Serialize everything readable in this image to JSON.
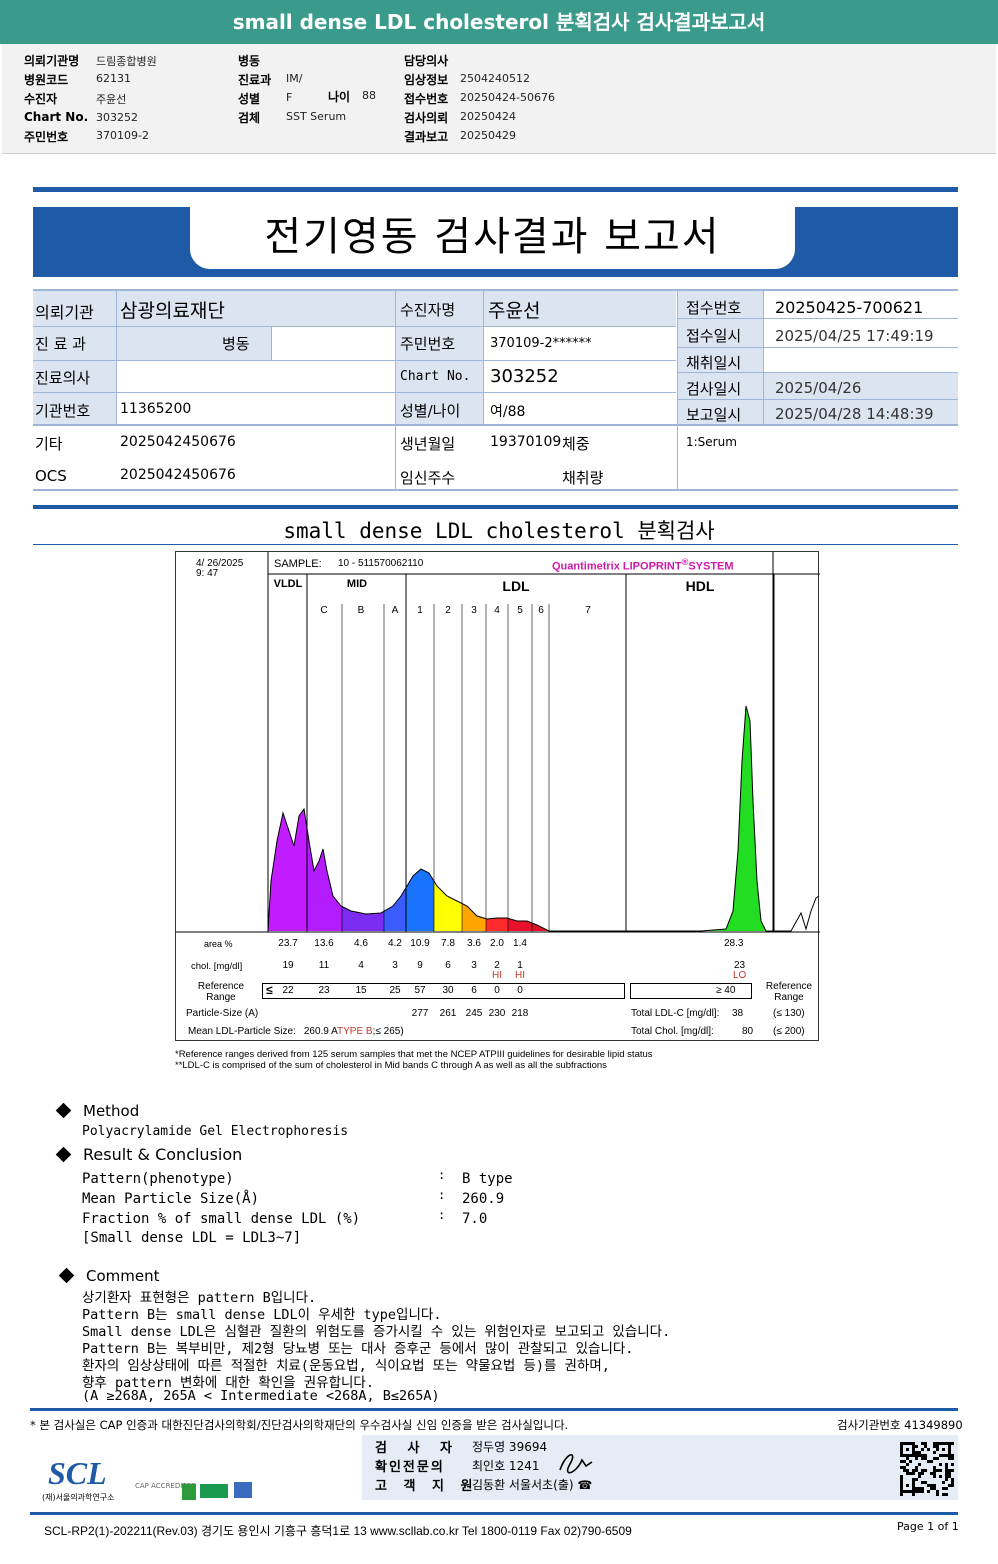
{
  "title": "small dense LDL cholesterol 분획검사 검사결과보고서",
  "header": {
    "col1": [
      {
        "label": "의뢰기관명",
        "value": "드림종합병원"
      },
      {
        "label": "병원코드",
        "value": "62131"
      },
      {
        "label": "수진자",
        "value": "주윤선"
      },
      {
        "label": "Chart No.",
        "value": "303252"
      },
      {
        "label": "주민번호",
        "value": "370109-2"
      }
    ],
    "col2": [
      {
        "label": "병동",
        "value": ""
      },
      {
        "label": "진료과",
        "value": "IM/"
      },
      {
        "label": "성별",
        "value": "F"
      },
      {
        "label": "검체",
        "value": "SST Serum"
      }
    ],
    "age_label": "나이",
    "age_value": "88",
    "col3": [
      {
        "label": "담당의사",
        "value": ""
      },
      {
        "label": "임상정보",
        "value": "2504240512"
      },
      {
        "label": "접수번호",
        "value": "20250424-50676"
      },
      {
        "label": "검사의뢰",
        "value": "20250424"
      },
      {
        "label": "결과보고",
        "value": "20250429"
      }
    ]
  },
  "report_title": "전기영동 검사결과 보고서",
  "info": {
    "org_label": "의뢰기관",
    "org": "삼광의료재단",
    "dept_label": "진 료 과",
    "ward_label": "병동",
    "doctor_label": "진료의사",
    "inst_label": "기관번호",
    "inst": "11365200",
    "etc_label": "기타",
    "etc": "2025042450676",
    "ocs_label": "OCS",
    "ocs": "2025042450676",
    "name_label": "수진자명",
    "name": "주윤선",
    "rrn_label": "주민번호",
    "rrn": "370109-2******",
    "chart_label": "Chart No.",
    "chart": "303252",
    "sex_label": "성별/나이",
    "sex": "여/88",
    "birth_label": "생년월일",
    "birth": "19370109",
    "weight_label": "체중",
    "preg_label": "임신주수",
    "amount_label": "채취량",
    "recv_no_label": "접수번호",
    "recv_no": "20250425-700621",
    "recv_dt_label": "접수일시",
    "recv_dt": "2025/04/25 17:49:19",
    "coll_dt_label": "채취일시",
    "test_dt_label": "검사일시",
    "test_dt": "2025/04/26",
    "report_dt_label": "보고일시",
    "report_dt": "2025/04/28 14:48:39",
    "specimen": "1:Serum"
  },
  "section_title": "small dense LDL cholesterol 분획검사",
  "lipoprint": {
    "date": "4/ 26/2025",
    "time": "9: 47",
    "sample_label": "SAMPLE:",
    "sample": "10 - 511570062110",
    "brand": "Quantimetrix LIPOPRINT",
    "brand_mark": "®",
    "brand_suffix": "SYSTEM",
    "groups": [
      "VLDL",
      "MID",
      "LDL",
      "HDL"
    ],
    "bands": [
      "C",
      "B",
      "A",
      "1",
      "2",
      "3",
      "4",
      "5",
      "6",
      "7"
    ],
    "band_colors": [
      "#b31cff",
      "#7b2cf0",
      "#3b5cff",
      "#1a73ff",
      "#ffff00",
      "#ffa500",
      "#ff2a2a",
      "#e8102a",
      "#e0102a",
      "#d0102a"
    ],
    "hdl_color": "#22dd22",
    "area_label": "area %",
    "area": [
      "23.7",
      "13.6",
      "4.6",
      "4.2",
      "10.9",
      "7.8",
      "3.6",
      "2.0",
      "1.4"
    ],
    "area_hdl": "28.3",
    "chol_label": "chol. [mg/dl]",
    "chol": [
      "19",
      "11",
      "4",
      "3",
      "9",
      "6",
      "3",
      "2",
      "1"
    ],
    "chol_hdl": "23",
    "flags": [
      "",
      "",
      "",
      "",
      "",
      "",
      "",
      "HI",
      "HI"
    ],
    "flag_hdl": "LO",
    "ref_label": "Reference Range",
    "ref_prefix": "≤",
    "ref": [
      "22",
      "23",
      "15",
      "25",
      "57",
      "30",
      "6",
      "0",
      "0"
    ],
    "ref_hdl": "≥  40",
    "ref_label_right": "Reference Range",
    "size_label": "Particle-Size (A)",
    "sizes": [
      "277",
      "261",
      "245",
      "230",
      "218"
    ],
    "mean_label": "Mean LDL-Particle Size:",
    "mean": "260.9 A",
    "mean_type": "TYPE B",
    "mean_ref": ";≤ 265)",
    "ldlc_label": "Total LDL-C [mg/dl]:",
    "ldlc": "38",
    "ldlc_ref": "(≤ 130)",
    "tchol_label": "Total Chol. [mg/dl]:",
    "tchol": "80",
    "tchol_ref": "(≤ 200)",
    "note1": "*Reference ranges derived from 125 serum samples that met the NCEP ATPIII guidelines for desirable lipid status",
    "note2": "**LDL-C is comprised of the sum of cholesterol in Mid bands C through A as well as all the subfractions"
  },
  "method": {
    "title": "Method",
    "text": "Polyacrylamide Gel Electrophoresis"
  },
  "result": {
    "title": "Result & Conclusion",
    "rows": [
      {
        "label": "Pattern(phenotype)",
        "value": "B type"
      },
      {
        "label": "Mean Particle Size(Å)",
        "value": "260.9"
      },
      {
        "label": "Fraction % of small dense LDL (%)",
        "value": "7.0"
      }
    ],
    "note": "[Small dense LDL = LDL3~7]"
  },
  "comment": {
    "title": "Comment",
    "lines": [
      "상기환자 표현형은 pattern B입니다.",
      "Pattern B는 small dense LDL이 우세한 type입니다.",
      "Small dense LDL은 심혈관 질환의 위험도를 증가시킬 수 있는 위험인자로 보고되고 있습니다.",
      "Pattern B는 복부비만, 제2형 당뇨병 또는 대사 증후군 등에서 많이 관찰되고 있습니다.",
      "환자의 임상상태에 따른 적절한 치료(운동요법, 식이요법 또는 약물요법 등)를 권하며,",
      "향후 pattern 변화에 대한 확인을 권유합니다.",
      "(A ≥268A, 265A < Intermediate <268A, B≤265A)"
    ]
  },
  "footer": {
    "cert": "* 본 검사실은 CAP 인증과 대한진단검사의학회/진단검사의학재단의 우수검사실 신임 인증을 받은 검사실입니다.",
    "lab_no": "검사기관번호 41349890",
    "tester_label": "검 사 자",
    "tester": "정두영 39694",
    "doctor_label": "확인전문의",
    "doctor": "최인호 1241",
    "support_label": "고 객 지 원",
    "support": "김동환 서울서초(출) ☎",
    "logo": "SCL",
    "logo_sub": "(재)서울의과학연구소",
    "accreditations": "CAP ACCREDITED",
    "address": "SCL-RP2(1)-202211(Rev.03) 경기도 용인시 기흥구 흥덕1로 13 www.scllab.co.kr Tel 1800-0119 Fax 02)790-6509",
    "page": "Page 1 of 1"
  }
}
